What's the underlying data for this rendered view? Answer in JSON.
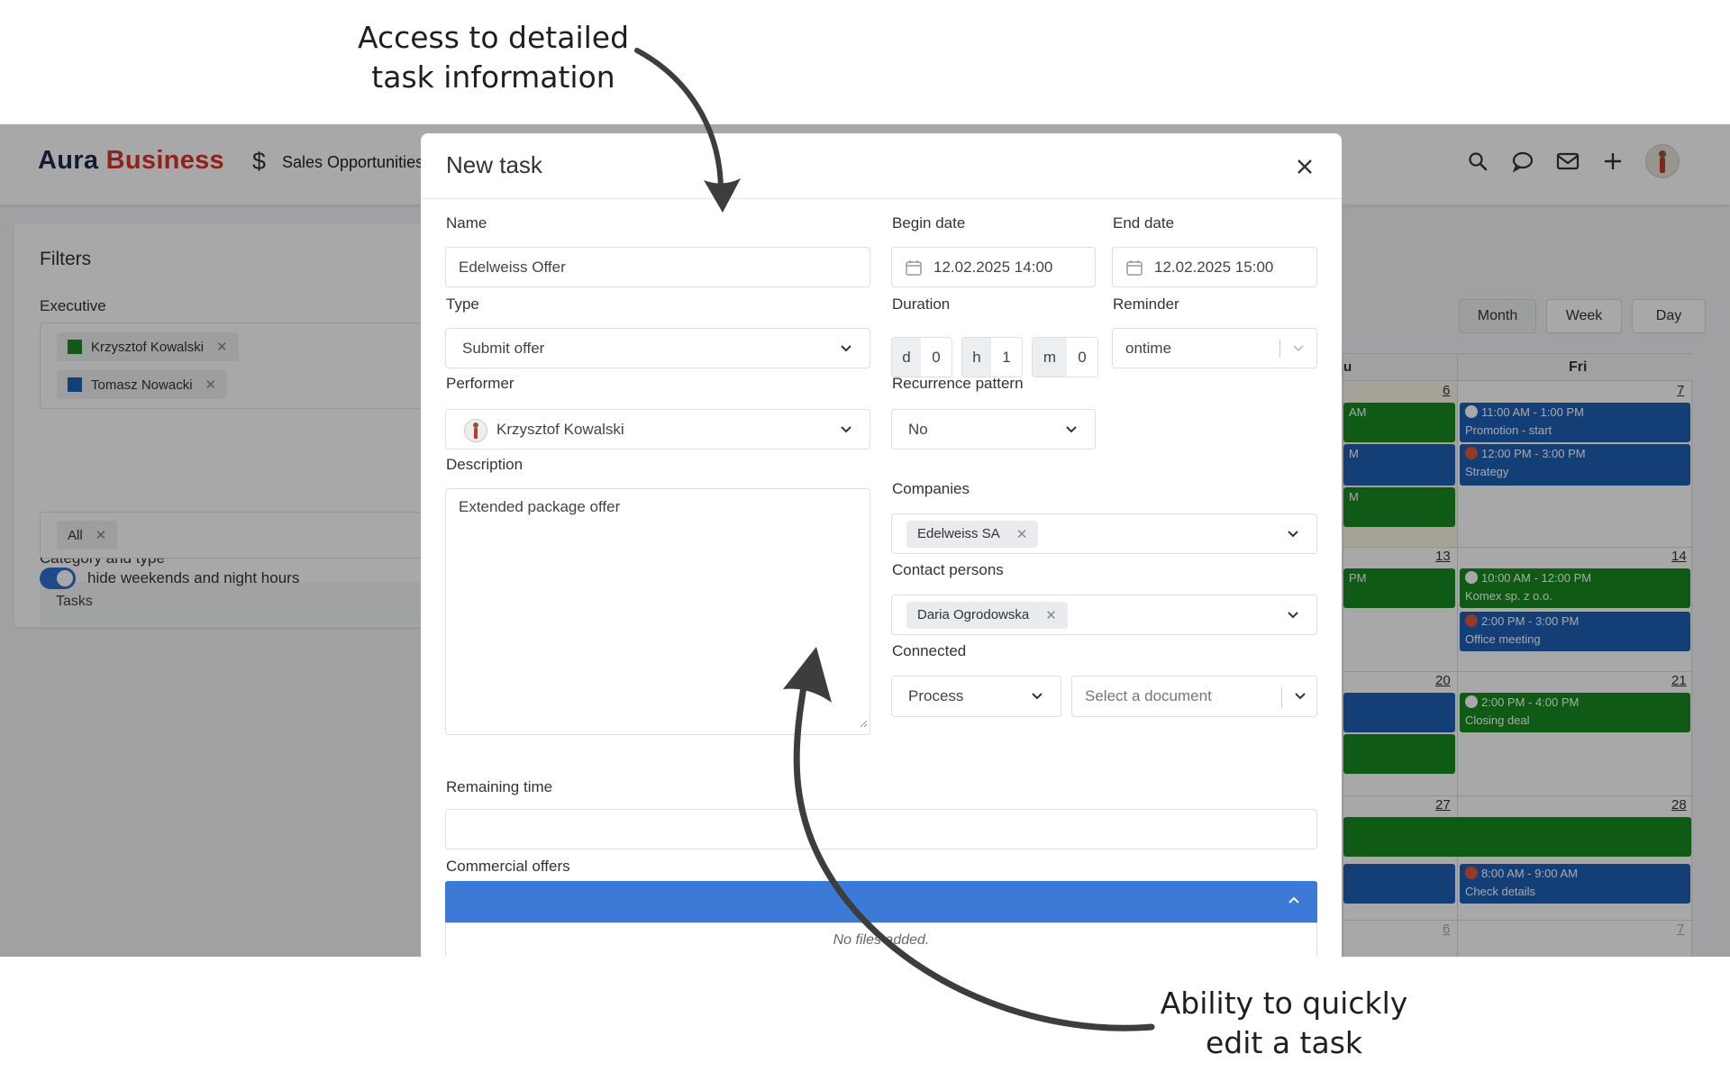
{
  "annotations": {
    "top_line1": "Access to detailed",
    "top_line2": "task information",
    "bottom_line1": "Ability to quickly",
    "bottom_line2": "edit a task"
  },
  "app": {
    "brand_part1": "Aura",
    "brand_part2": "Business",
    "nav_item": "Sales Opportunities"
  },
  "filters": {
    "title": "Filters",
    "executive_label": "Executive",
    "executives": [
      {
        "name": "Krzysztof Kowalski",
        "color": "#188a22"
      },
      {
        "name": "Tomasz Nowacki",
        "color": "#1f5fb4"
      }
    ],
    "category_label": "Category and type",
    "category_value": "Tasks",
    "type_chip": "All",
    "toggle_label": "hide weekends and night hours"
  },
  "calendar": {
    "views": [
      "Month",
      "Week",
      "Day"
    ],
    "col_headers": [
      "u",
      "Fri"
    ],
    "days": [
      "6",
      "7",
      "13",
      "14",
      "20",
      "21",
      "27",
      "28",
      "6",
      "7"
    ],
    "events": [
      {
        "time": "11:00 AM - 1:00 PM",
        "title": "Promotion - start"
      },
      {
        "time": "12:00 PM - 3:00 PM",
        "title": "Strategy"
      },
      {
        "time": "10:00 AM - 12:00 PM",
        "title": "Komex sp. z o.o."
      },
      {
        "time": "2:00 PM - 3:00 PM",
        "title": "Office meeting"
      },
      {
        "time": "2:00 PM - 4:00 PM",
        "title": "Closing deal"
      },
      {
        "time": "8:00 AM - 9:00 AM",
        "title": "Check details"
      }
    ],
    "partial_labels": [
      "AM",
      "M",
      "M",
      "PM"
    ]
  },
  "modal": {
    "title": "New task",
    "name_label": "Name",
    "name_value": "Edelweiss Offer",
    "begin_label": "Begin date",
    "begin_value": "12.02.2025 14:00",
    "end_label": "End date",
    "end_value": "12.02.2025 15:00",
    "type_label": "Type",
    "type_value": "Submit offer",
    "duration_label": "Duration",
    "duration": {
      "d_unit": "d",
      "d_value": "0",
      "h_unit": "h",
      "h_value": "1",
      "m_unit": "m",
      "m_value": "0"
    },
    "reminder_label": "Reminder",
    "reminder_value": "ontime",
    "performer_label": "Performer",
    "performer_value": "Krzysztof Kowalski",
    "recurrence_label": "Recurrence pattern",
    "recurrence_value": "No",
    "description_label": "Description",
    "description_value": "Extended package offer",
    "companies_label": "Companies",
    "companies_tag": "Edelweiss SA",
    "contacts_label": "Contact persons",
    "contacts_tag": "Daria Ogrodowska",
    "connected_label": "Connected",
    "connected_process": "Process",
    "connected_document_placeholder": "Select a document",
    "remaining_label": "Remaining time",
    "offers_label": "Commercial offers",
    "no_files": "No files added."
  }
}
